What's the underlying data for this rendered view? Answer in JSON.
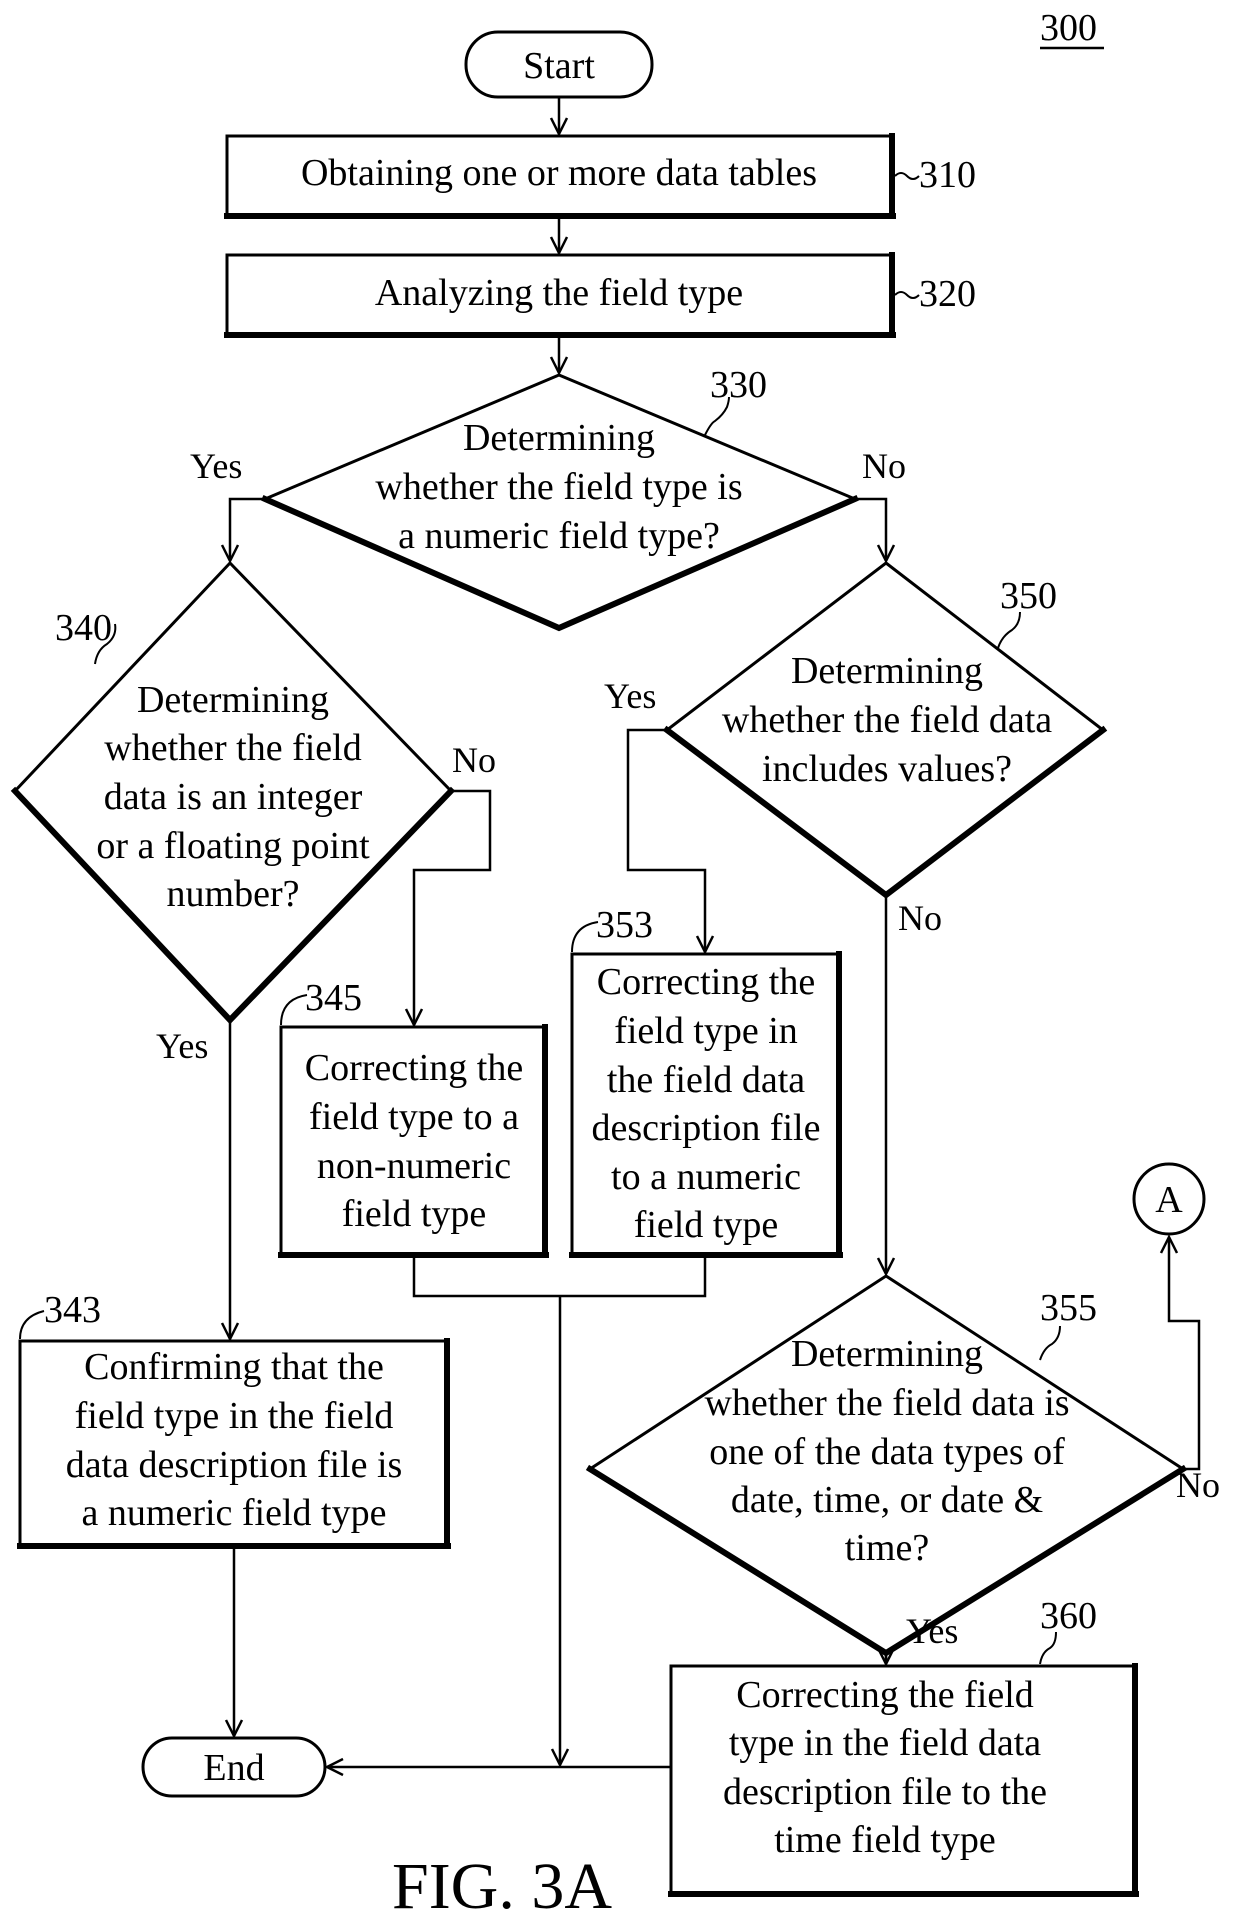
{
  "figure": {
    "number": "300",
    "caption": "FIG. 3A"
  },
  "nodes": {
    "start": {
      "label": "Start"
    },
    "end": {
      "label": "End"
    },
    "n310": {
      "ref": "310",
      "lines": [
        "Obtaining one or more data tables"
      ]
    },
    "n320": {
      "ref": "320",
      "lines": [
        "Analyzing the field type"
      ]
    },
    "n330": {
      "ref": "330",
      "lines": [
        "Determining",
        "whether the field type is",
        "a numeric field type?"
      ]
    },
    "n340": {
      "ref": "340",
      "lines": [
        "Determining",
        "whether the field",
        "data is an integer",
        "or a floating point",
        "number?"
      ]
    },
    "n343": {
      "ref": "343",
      "lines": [
        "Confirming that the",
        "field type in the field",
        "data description file is",
        "a numeric field type"
      ]
    },
    "n345": {
      "ref": "345",
      "lines": [
        "Correcting the",
        "field type to a",
        "non-numeric",
        "field type"
      ]
    },
    "n350": {
      "ref": "350",
      "lines": [
        "Determining",
        "whether the field data",
        "includes values?"
      ]
    },
    "n353": {
      "ref": "353",
      "lines": [
        "Correcting the",
        "field type in",
        "the field data",
        "description file",
        "to a numeric",
        "field type"
      ]
    },
    "n355": {
      "ref": "355",
      "lines": [
        "Determining",
        "whether the field data is",
        "one of the data types of",
        "date, time, or date &",
        "time?"
      ]
    },
    "n360": {
      "ref": "360",
      "lines": [
        "Correcting the field",
        "type in the field data",
        "description file to the",
        "time field type"
      ]
    },
    "connector_a": {
      "label": "A"
    }
  },
  "branches": {
    "b330_yes": "Yes",
    "b330_no": "No",
    "b340_no": "No",
    "b340_yes": "Yes",
    "b350_yes": "Yes",
    "b350_no": "No",
    "b355_no": "No",
    "b355_yes": "Yes"
  }
}
